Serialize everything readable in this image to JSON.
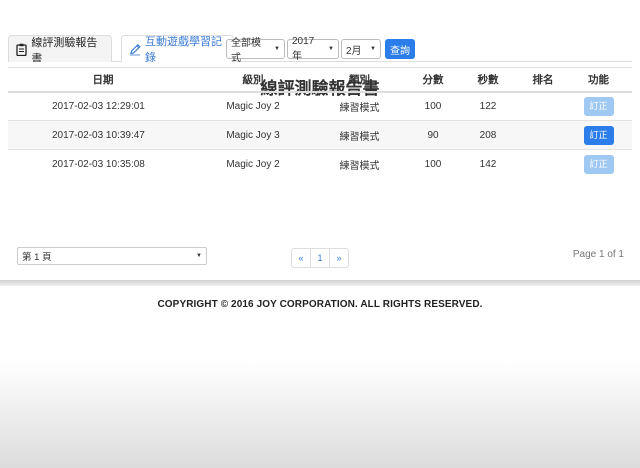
{
  "tabs": [
    {
      "label": "線評測驗報告書",
      "icon": "clipboard-icon",
      "active": true
    },
    {
      "label": "互動遊戲學習記錄",
      "icon": "pencil-icon",
      "active": false
    }
  ],
  "page_title": "線評測驗報告書",
  "filters": {
    "mode": "全部模式",
    "year": "2017年",
    "month": "2月",
    "query_label": "查詢"
  },
  "table": {
    "headers": [
      "日期",
      "級別",
      "類別",
      "分數",
      "秒數",
      "排名",
      "功能"
    ],
    "rows": [
      {
        "date": "2017-02-03 12:29:01",
        "level": "Magic Joy 2",
        "category": "練習模式",
        "score": "100",
        "seconds": "122",
        "rank": "",
        "action": "訂正",
        "action_enabled": false
      },
      {
        "date": "2017-02-03 10:39:47",
        "level": "Magic Joy 3",
        "category": "練習模式",
        "score": "90",
        "seconds": "208",
        "rank": "",
        "action": "訂正",
        "action_enabled": true
      },
      {
        "date": "2017-02-03 10:35:08",
        "level": "Magic Joy 2",
        "category": "練習模式",
        "score": "100",
        "seconds": "142",
        "rank": "",
        "action": "訂正",
        "action_enabled": false
      }
    ]
  },
  "pager": {
    "page_select": "第 1 頁",
    "prev": "«",
    "current": "1",
    "next": "»",
    "info": "Page 1 of 1"
  },
  "colors": {
    "accent": "#2b7de9",
    "accent_disabled": "#9fc8f3",
    "link": "#3a7bd5"
  },
  "footer": {
    "copyright": "COPYRIGHT © 2016 JOY CORPORATION. ALL RIGHTS RESERVED."
  }
}
